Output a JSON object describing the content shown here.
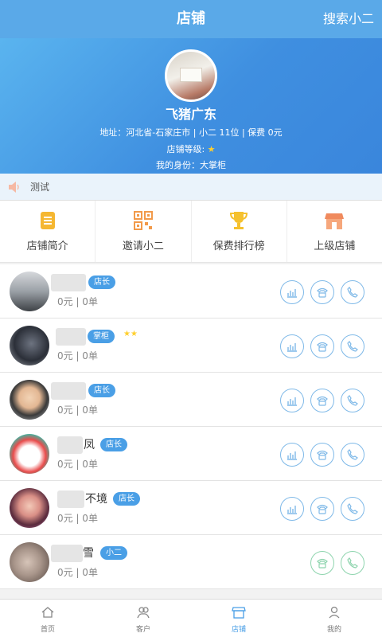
{
  "header": {
    "title": "店铺",
    "search_label": "搜索小二"
  },
  "shop": {
    "name": "飞猪广东",
    "address_line": "地址：河北省-石家庄市 | 小二  11位 | 保费 0元",
    "level_label": "店铺等级:",
    "level_stars": "★",
    "identity_line": "我的身份：大掌柜"
  },
  "notice": {
    "text": "测试",
    "icon": "speaker-icon"
  },
  "menu": [
    {
      "label": "店铺简介",
      "icon": "document-icon",
      "color": "#f5b731"
    },
    {
      "label": "邀请小二",
      "icon": "qrcode-icon",
      "color": "#f29a4a"
    },
    {
      "label": "保费排行榜",
      "icon": "trophy-icon",
      "color": "#f5c12e"
    },
    {
      "label": "上级店铺",
      "icon": "store-icon",
      "color": "#f08a5d"
    }
  ],
  "members": [
    {
      "name_visible": "",
      "badge": "店长",
      "stars": "",
      "stats": "0元 | 0单"
    },
    {
      "name_visible": "",
      "badge": "掌柜",
      "stars": "★★",
      "stats": "0元 | 0单"
    },
    {
      "name_visible": "",
      "badge": "店长",
      "stars": "",
      "stats": "0元 | 0单"
    },
    {
      "name_visible": "凤",
      "badge": "店长",
      "stars": "",
      "stats": "0元 | 0单"
    },
    {
      "name_visible": "不境",
      "badge": "店长",
      "stars": "",
      "stats": "0元 | 0单"
    },
    {
      "name_visible": "雪",
      "badge": "小二",
      "stars": "",
      "stats": "0元 | 0单"
    }
  ],
  "tabs": [
    {
      "label": "首页",
      "icon": "home-icon"
    },
    {
      "label": "客户",
      "icon": "customers-icon"
    },
    {
      "label": "店铺",
      "icon": "shop-icon",
      "active": true
    },
    {
      "label": "我的",
      "icon": "profile-icon"
    }
  ],
  "colors": {
    "primary": "#4a9fe6",
    "header": "#5aa9e8",
    "star": "#ffcf2e",
    "green_action": "#8ed4ae"
  }
}
